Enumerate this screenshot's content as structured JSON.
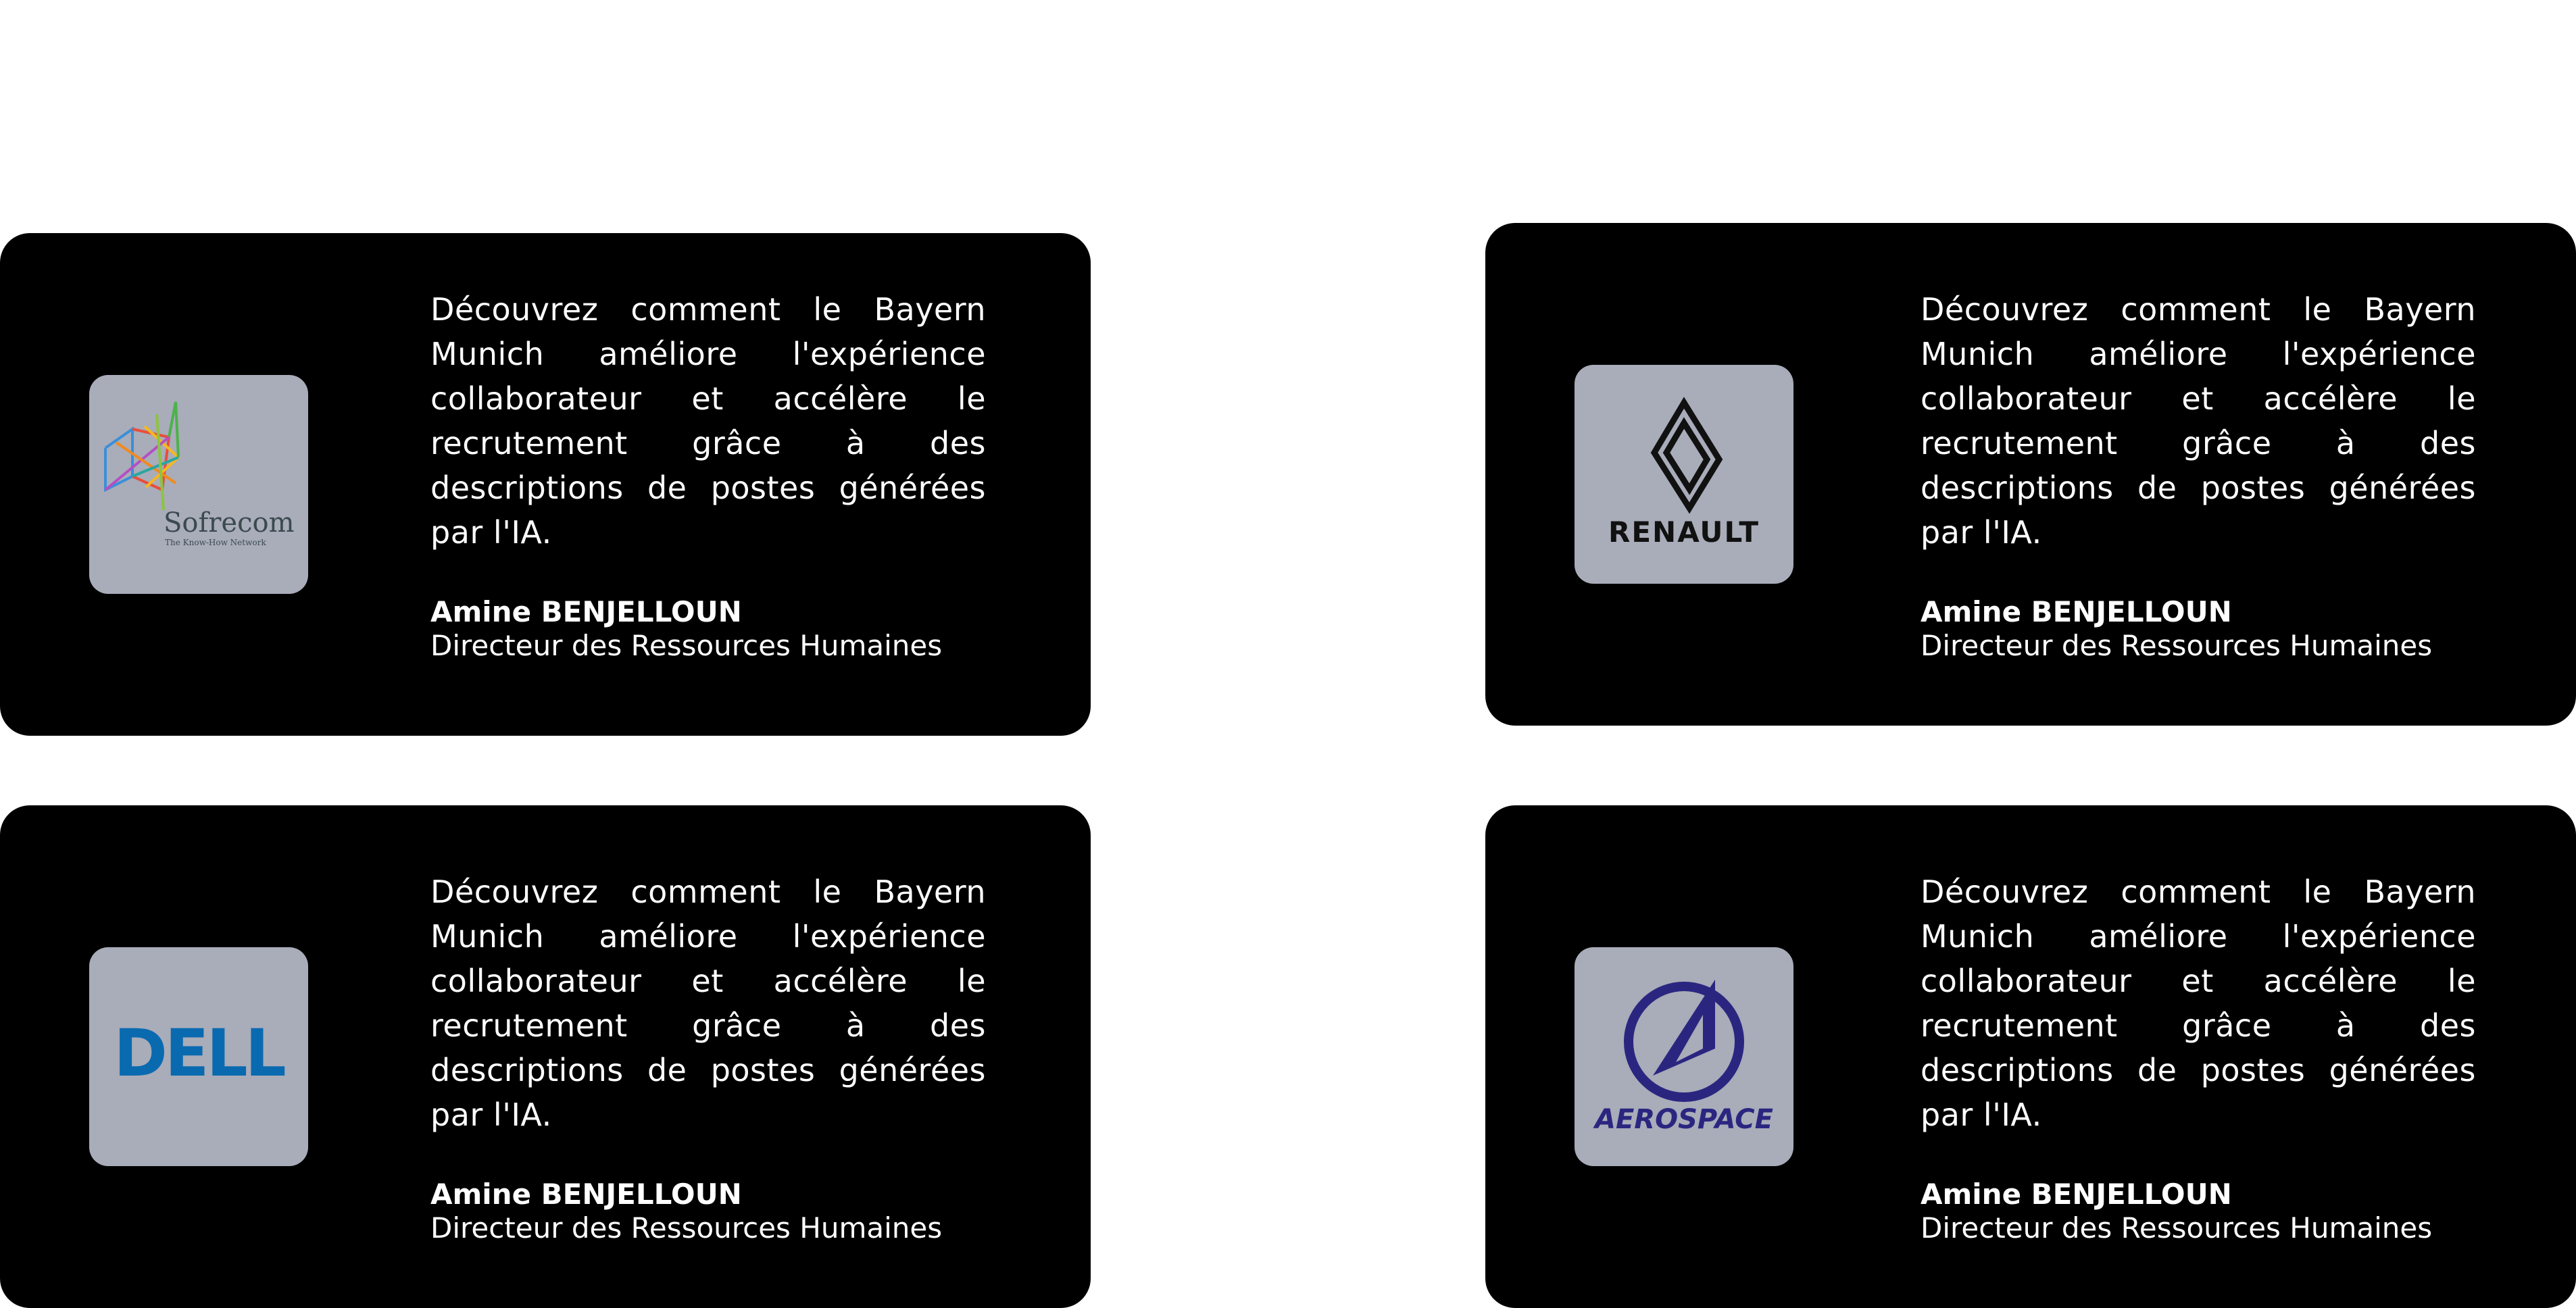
{
  "testimonials": [
    {
      "logo": {
        "name": "Sofrecom",
        "tagline": "The Know-How Network",
        "icon": "sofrecom-logo"
      },
      "quote": "Découvrez comment le Bayern Munich améliore l'expérience collaborateur et accélère le recrutement grâce à des descriptions de postes générées par l'IA.",
      "author": "Amine BENJELLOUN",
      "role": "Directeur des Ressources Humaines"
    },
    {
      "logo": {
        "name": "RENAULT",
        "icon": "renault-logo"
      },
      "quote": "Découvrez comment le Bayern Munich améliore l'expérience collaborateur et accélère le recrutement grâce à des descriptions de postes générées par l'IA.",
      "author": "Amine BENJELLOUN",
      "role": "Directeur des Ressources Humaines"
    },
    {
      "logo": {
        "name": "DELL",
        "icon": "dell-logo"
      },
      "quote": "Découvrez comment le Bayern Munich améliore l'expérience collaborateur et accélère le recrutement grâce à des descriptions de postes générées par l'IA.",
      "author": "Amine BENJELLOUN",
      "role": "Directeur des Ressources Humaines"
    },
    {
      "logo": {
        "name": "AEROSPACE",
        "icon": "aerospace-logo"
      },
      "quote": "Découvrez comment le Bayern Munich améliore l'expérience collaborateur et accélère le recrutement grâce à des descriptions de postes générées par l'IA.",
      "author": "Amine BENJELLOUN",
      "role": "Directeur des Ressources Humaines"
    }
  ],
  "colors": {
    "card_background": "#000000",
    "logo_background": "#a9acb9",
    "text": "#ffffff",
    "dell_blue": "#0a6ab0",
    "aerospace_navy": "#2a2680",
    "sofrecom_text": "#3a4a4f"
  }
}
